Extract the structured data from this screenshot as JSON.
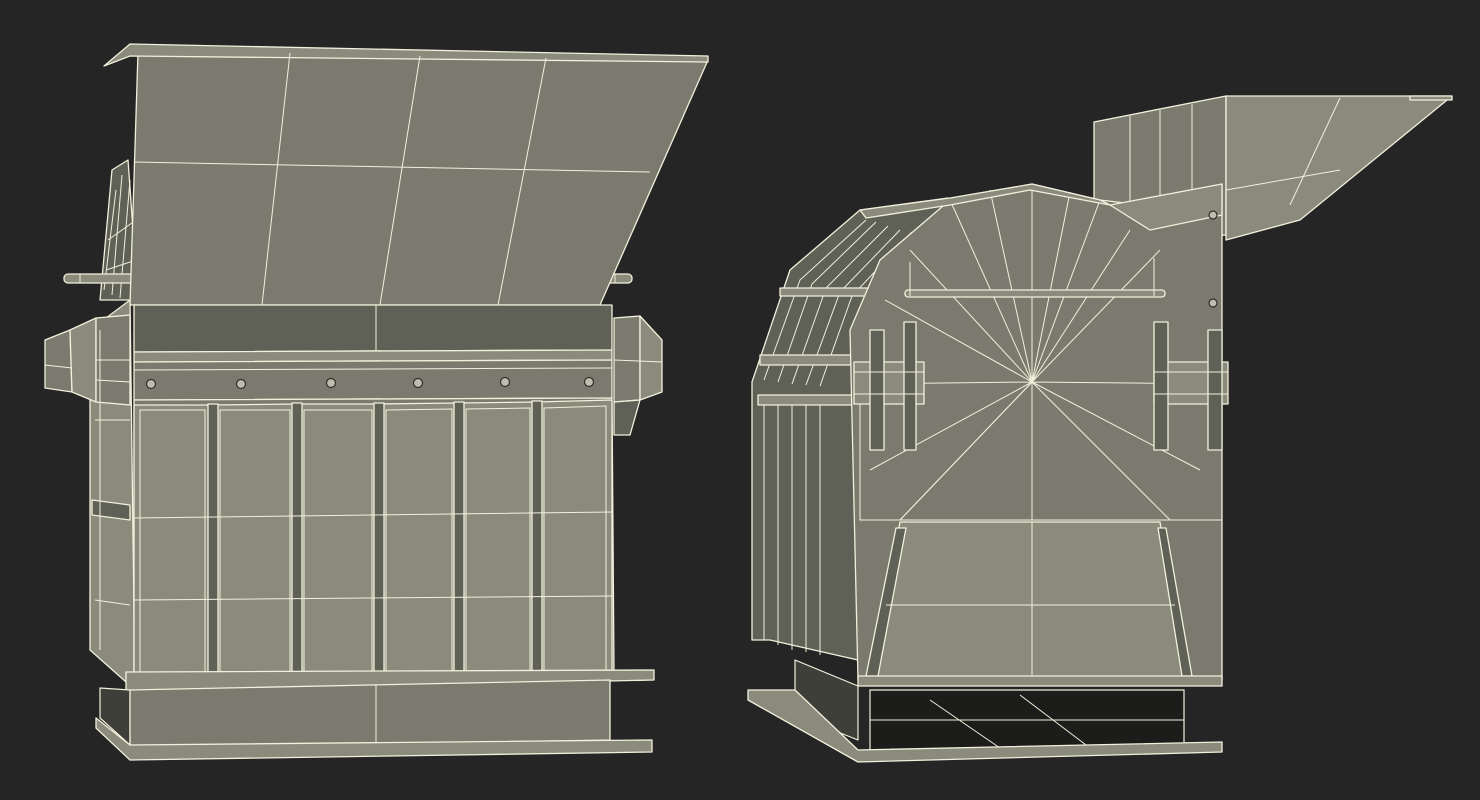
{
  "scene": {
    "background": "#252525",
    "model_fill": "#7a7b6e",
    "wireframe_color": "#f2f0dc",
    "views": [
      "front-view",
      "three-quarter-view"
    ]
  }
}
